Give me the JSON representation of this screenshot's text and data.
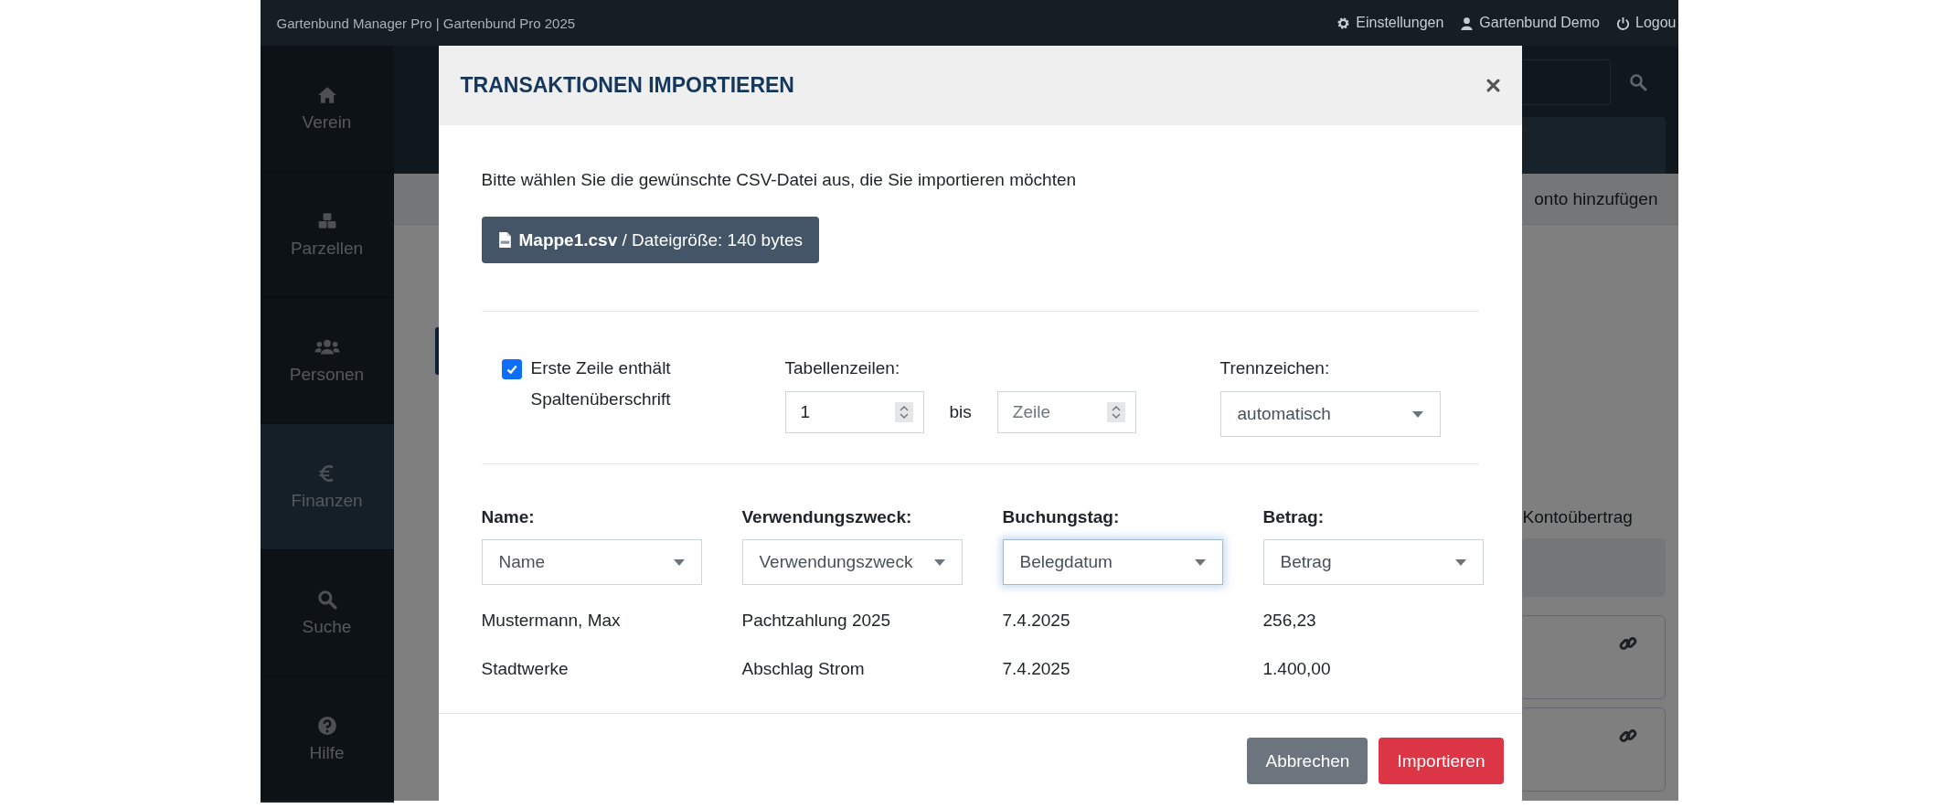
{
  "topbar": {
    "title": "Gartenbund Manager Pro | Gartenbund Pro 2025",
    "links": [
      {
        "label": "Einstellungen",
        "kind": "gear"
      },
      {
        "label": "Gartenbund Demo",
        "kind": "user"
      },
      {
        "label": "Logou",
        "kind": "power"
      }
    ]
  },
  "sidebar": {
    "items": [
      {
        "label": "Verein",
        "kind": "home",
        "selected": false
      },
      {
        "label": "Parzellen",
        "kind": "cubes",
        "selected": false
      },
      {
        "label": "Personen",
        "kind": "users",
        "selected": false
      },
      {
        "label": "Finanzen",
        "kind": "euro",
        "selected": true
      },
      {
        "label": "Suche",
        "kind": "search",
        "selected": false
      },
      {
        "label": "Hilfe",
        "kind": "help",
        "selected": false
      }
    ]
  },
  "background": {
    "add_account": "onto hinzufügen",
    "transfer_label": "Kontoübertrag"
  },
  "modal": {
    "title": "TRANSAKTIONEN IMPORTIEREN",
    "intro": "Bitte wählen Sie die gewünschte CSV-Datei aus, die Sie importieren möchten",
    "file": "**Mappe1.csv** / Dateigröße: 140 bytes",
    "header_row": {
      "label": "Erste Zeile enthält Spaltenüberschrift",
      "checked": true
    },
    "rows_label": "Tabellenzeilen:",
    "from": {
      "value": "1"
    },
    "to_word": "bis",
    "to": {
      "placeholder": "Zeile"
    },
    "separator": {
      "label": "Trennzeichen:",
      "value": "automatisch"
    },
    "mapping": [
      {
        "label": "Name:",
        "value": "Name",
        "focused": false
      },
      {
        "label": "Verwendungszweck:",
        "value": "Verwendungszweck",
        "focused": false
      },
      {
        "label": "Buchungstag:",
        "value": "Belegdatum",
        "focused": true
      },
      {
        "label": "Betrag:",
        "value": "Betrag",
        "focused": false
      }
    ],
    "preview_rows": [
      [
        "Mustermann, Max",
        "Pachtzahlung 2025",
        "7.4.2025",
        "256,23"
      ],
      [
        "Stadtwerke",
        "Abschlag Strom",
        "7.4.2025",
        "1.400,00"
      ]
    ],
    "buttons": [
      {
        "label": "Abbrechen",
        "kind": "secondary"
      },
      {
        "label": "Importieren",
        "kind": "danger"
      }
    ]
  }
}
